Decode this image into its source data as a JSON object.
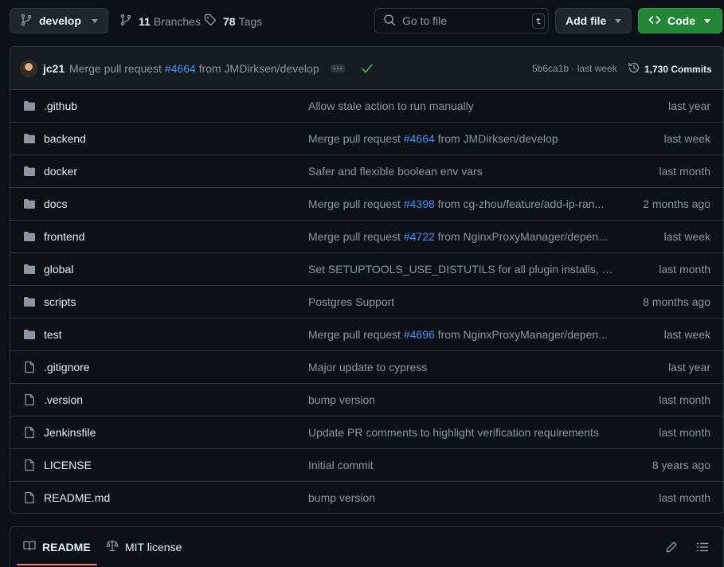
{
  "toolbar": {
    "branch": "develop",
    "branches_count": "11",
    "branches_label": "Branches",
    "tags_count": "78",
    "tags_label": "Tags",
    "search_placeholder": "Go to file",
    "search_shortcut": "t",
    "add_file_label": "Add file",
    "code_label": "Code"
  },
  "latest_commit": {
    "author": "jc21",
    "message_prefix": "Merge pull request",
    "pr": "#4664",
    "message_suffix": "from JMDirksen/develop",
    "sha_time": "5b6ca1b · last week",
    "commits_label": "1,730 Commits"
  },
  "files": [
    {
      "name": ".github",
      "type": "folder",
      "msg_prefix": "Allow stale action to run manually",
      "pr": "",
      "msg_suffix": "",
      "date": "last year"
    },
    {
      "name": "backend",
      "type": "folder",
      "msg_prefix": "Merge pull request ",
      "pr": "#4664",
      "msg_suffix": " from JMDirksen/develop",
      "date": "last week"
    },
    {
      "name": "docker",
      "type": "folder",
      "msg_prefix": "Safer and flexible boolean env vars",
      "pr": "",
      "msg_suffix": "",
      "date": "last month"
    },
    {
      "name": "docs",
      "type": "folder",
      "msg_prefix": "Merge pull request ",
      "pr": "#4398",
      "msg_suffix": " from cg-zhou/feature/add-ip-ran...",
      "date": "2 months ago"
    },
    {
      "name": "frontend",
      "type": "folder",
      "msg_prefix": "Merge pull request ",
      "pr": "#4722",
      "msg_suffix": " from NginxProxyManager/depen...",
      "date": "last week"
    },
    {
      "name": "global",
      "type": "folder",
      "msg_prefix": "Set SETUPTOOLS_USE_DISTUTILS for all plugin installs, seem...",
      "pr": "",
      "msg_suffix": "",
      "date": "last month"
    },
    {
      "name": "scripts",
      "type": "folder",
      "msg_prefix": "Postgres Support",
      "pr": "",
      "msg_suffix": "",
      "date": "8 months ago"
    },
    {
      "name": "test",
      "type": "folder",
      "msg_prefix": "Merge pull request ",
      "pr": "#4696",
      "msg_suffix": " from NginxProxyManager/depen...",
      "date": "last week"
    },
    {
      "name": ".gitignore",
      "type": "file",
      "msg_prefix": "Major update to cypress",
      "pr": "",
      "msg_suffix": "",
      "date": "last year"
    },
    {
      "name": ".version",
      "type": "file",
      "msg_prefix": "bump version",
      "pr": "",
      "msg_suffix": "",
      "date": "last month"
    },
    {
      "name": "Jenkinsfile",
      "type": "file",
      "msg_prefix": "Update PR comments to highlight verification requirements",
      "pr": "",
      "msg_suffix": "",
      "date": "last month"
    },
    {
      "name": "LICENSE",
      "type": "file",
      "msg_prefix": "Initial commit",
      "pr": "",
      "msg_suffix": "",
      "date": "8 years ago"
    },
    {
      "name": "README.md",
      "type": "file",
      "msg_prefix": "bump version",
      "pr": "",
      "msg_suffix": "",
      "date": "last month"
    }
  ],
  "readme_tabs": {
    "readme": "README",
    "license": "MIT license"
  },
  "colors": {
    "background": "#0d1117",
    "accent_link": "#4493f8",
    "code_button": "#238636",
    "check": "#3fb950",
    "tab_underline": "#f78166"
  }
}
